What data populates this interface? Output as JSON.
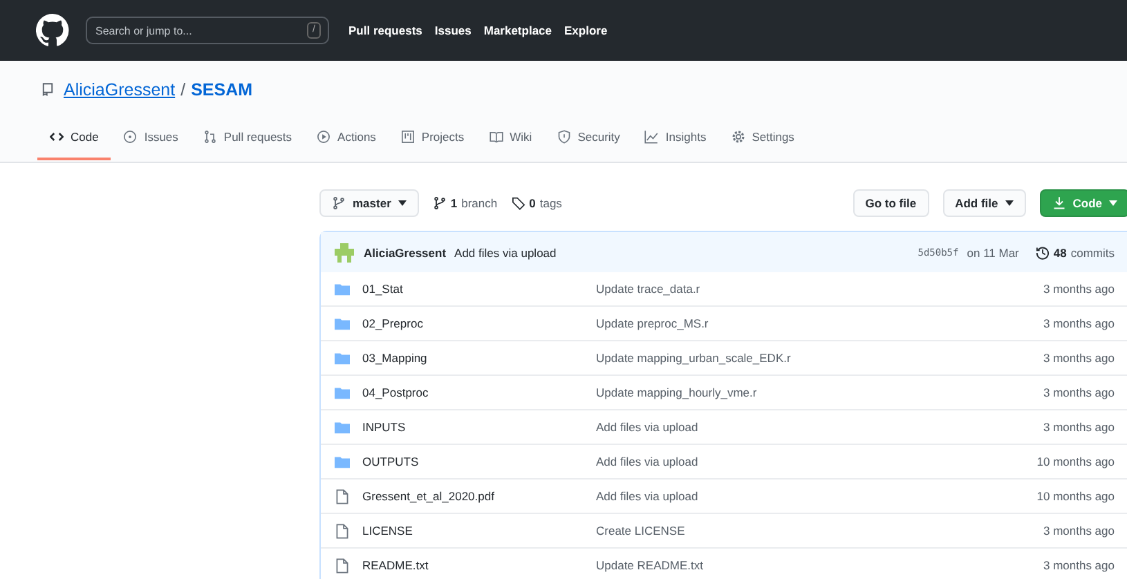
{
  "header": {
    "search": {
      "placeholder": "Search or jump to...",
      "shortcut": "/"
    },
    "nav": [
      "Pull requests",
      "Issues",
      "Marketplace",
      "Explore"
    ]
  },
  "repo": {
    "owner": "AliciaGressent",
    "separator": "/",
    "name": "SESAM"
  },
  "tabs": [
    {
      "label": "Code",
      "selected": true
    },
    {
      "label": "Issues",
      "selected": false
    },
    {
      "label": "Pull requests",
      "selected": false
    },
    {
      "label": "Actions",
      "selected": false
    },
    {
      "label": "Projects",
      "selected": false
    },
    {
      "label": "Wiki",
      "selected": false
    },
    {
      "label": "Security",
      "selected": false
    },
    {
      "label": "Insights",
      "selected": false
    },
    {
      "label": "Settings",
      "selected": false
    }
  ],
  "toolbar": {
    "branch": "master",
    "branches_count": "1",
    "branches_label": "branch",
    "tags_count": "0",
    "tags_label": "tags",
    "buttons": [
      "Go to file",
      "Add file",
      "Code"
    ]
  },
  "commit": {
    "author": "AliciaGressent",
    "message": "Add files via upload",
    "sha": "5d50b5f",
    "date": "on 11 Mar",
    "commits_count": "48",
    "commits_label": "commits"
  },
  "files": [
    {
      "kind": "folder",
      "name": "01_Stat",
      "message": "Update trace_data.r",
      "age": "3 months ago"
    },
    {
      "kind": "folder",
      "name": "02_Preproc",
      "message": "Update preproc_MS.r",
      "age": "3 months ago"
    },
    {
      "kind": "folder",
      "name": "03_Mapping",
      "message": "Update mapping_urban_scale_EDK.r",
      "age": "3 months ago"
    },
    {
      "kind": "folder",
      "name": "04_Postproc",
      "message": "Update mapping_hourly_vme.r",
      "age": "3 months ago"
    },
    {
      "kind": "folder",
      "name": "INPUTS",
      "message": "Add files via upload",
      "age": "3 months ago"
    },
    {
      "kind": "folder",
      "name": "OUTPUTS",
      "message": "Add files via upload",
      "age": "10 months ago"
    },
    {
      "kind": "file",
      "name": "Gressent_et_al_2020.pdf",
      "message": "Add files via upload",
      "age": "10 months ago"
    },
    {
      "kind": "file",
      "name": "LICENSE",
      "message": "Create LICENSE",
      "age": "3 months ago"
    },
    {
      "kind": "file",
      "name": "README.txt",
      "message": "Update README.txt",
      "age": "3 months ago"
    }
  ]
}
